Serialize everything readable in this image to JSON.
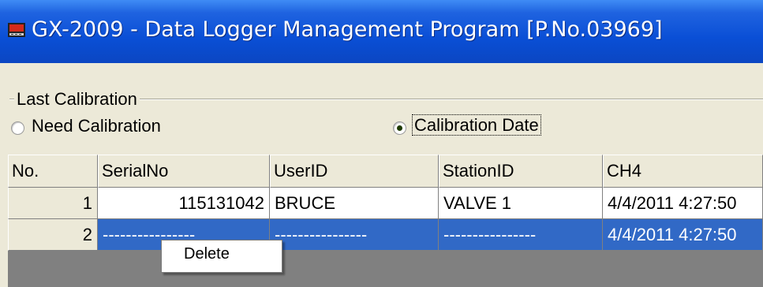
{
  "window": {
    "title": "GX-2009  - Data Logger Management Program [P.No.03969]",
    "icon": "app-monitor-icon"
  },
  "calibration_group": {
    "label": "Last Calibration",
    "options": [
      {
        "label": "Need Calibration",
        "selected": false
      },
      {
        "label": "Calibration Date",
        "selected": true
      }
    ]
  },
  "grid": {
    "columns": [
      "No.",
      "SerialNo",
      "UserID",
      "StationID",
      "CH4"
    ],
    "rows": [
      {
        "no": "1",
        "serial": "115131042",
        "user": "BRUCE",
        "station": "VALVE 1",
        "ch4": "4/4/2011 4:27:50",
        "selected": false
      },
      {
        "no": "2",
        "serial": "----------------",
        "user": "----------------",
        "station": "----------------",
        "ch4": "4/4/2011 4:27:50",
        "selected": true
      }
    ]
  },
  "context_menu": {
    "items": [
      "Delete"
    ]
  },
  "colors": {
    "titlebar": "#0a4fd6",
    "selection": "#3169c6",
    "face": "#ece9d8"
  }
}
